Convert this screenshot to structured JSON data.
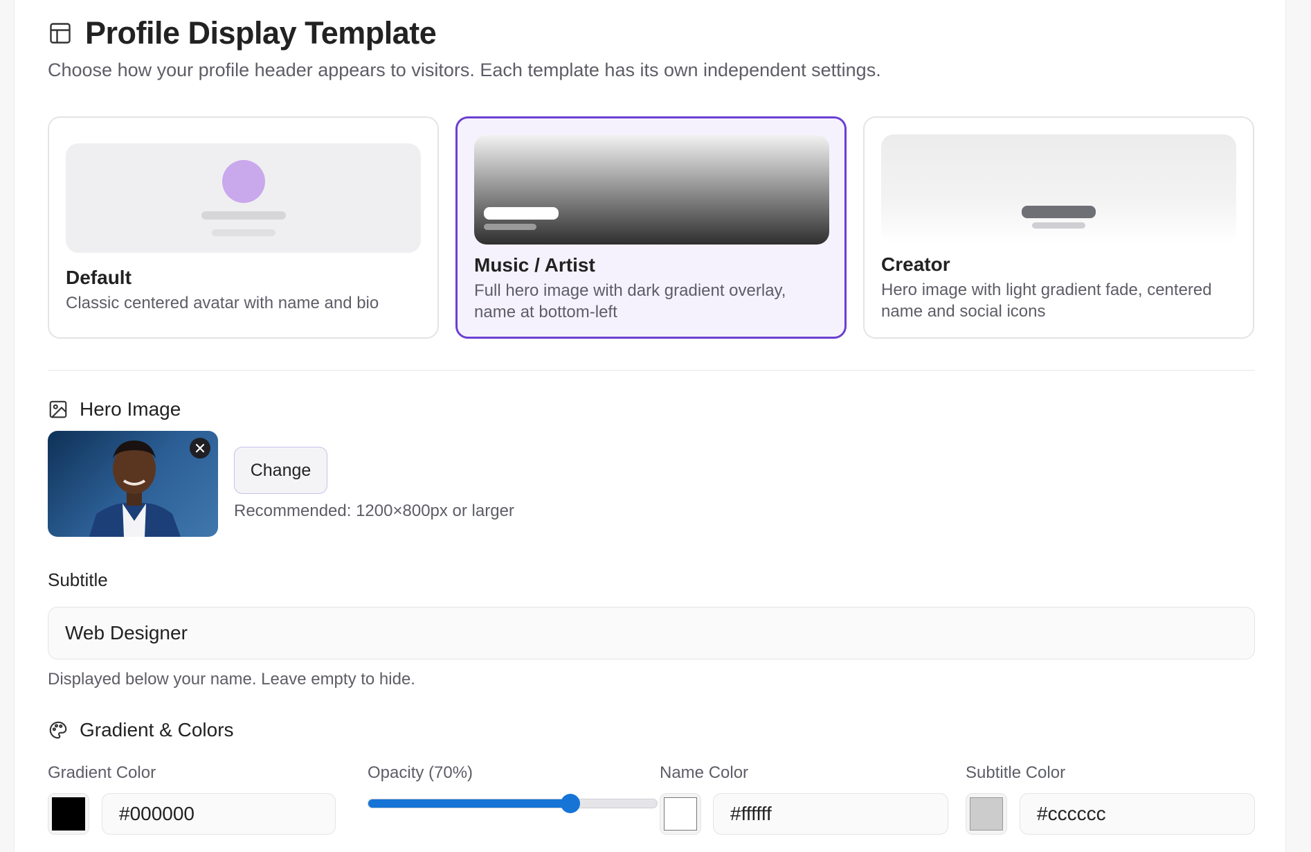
{
  "header": {
    "title": "Profile Display Template",
    "description": "Choose how your profile header appears to visitors. Each template has its own independent settings."
  },
  "templates": [
    {
      "name": "Default",
      "description": "Classic centered avatar with name and bio",
      "selected": false
    },
    {
      "name": "Music / Artist",
      "description": "Full hero image with dark gradient overlay, name at bottom-left",
      "selected": true
    },
    {
      "name": "Creator",
      "description": "Hero image with light gradient fade, centered name and social icons",
      "selected": false
    }
  ],
  "hero_image": {
    "section_label": "Hero Image",
    "change_label": "Change",
    "recommendation": "Recommended: 1200×800px or larger"
  },
  "subtitle": {
    "label": "Subtitle",
    "value": "Web Designer",
    "help": "Displayed below your name. Leave empty to hide."
  },
  "colors": {
    "section_label": "Gradient & Colors",
    "gradient_color": {
      "label": "Gradient Color",
      "value": "#000000"
    },
    "opacity": {
      "label": "Opacity (70%)",
      "value": 70
    },
    "name_color": {
      "label": "Name Color",
      "value": "#ffffff"
    },
    "subtitle_color": {
      "label": "Subtitle Color",
      "value": "#cccccc"
    },
    "accent": "#6b3fd1",
    "slider": "#1674d6"
  }
}
